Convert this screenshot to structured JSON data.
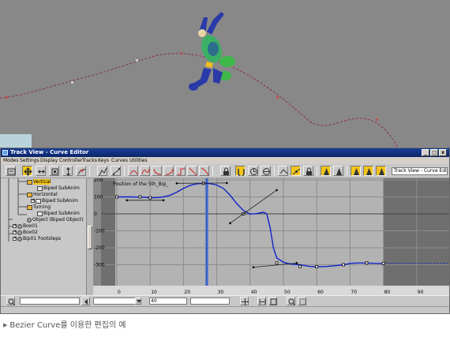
{
  "window": {
    "title": "Track View - Curve Editor",
    "min_label": "_",
    "max_label": "□",
    "close_label": "x"
  },
  "menu": [
    "Modes",
    "Settings",
    "Display",
    "Controller",
    "Tracks",
    "Keys",
    "Curves",
    "Utilities"
  ],
  "toolbar": {
    "name_field": "Track View - Curve Editor"
  },
  "hierarchy": {
    "rows": [
      {
        "label": "Vertical",
        "indent": 33,
        "icon": "orange",
        "selected": true,
        "expander": ""
      },
      {
        "label": "Biped SubAnim",
        "indent": 46,
        "icon": "box",
        "selected": false,
        "expander": ""
      },
      {
        "label": "Horizontal",
        "indent": 33,
        "icon": "orange",
        "selected": false,
        "expander": ""
      },
      {
        "label": "Biped SubAnim",
        "indent": 38,
        "icon": "box",
        "selected": false,
        "expander": "+"
      },
      {
        "label": "Turning",
        "indent": 33,
        "icon": "orange",
        "selected": false,
        "expander": ""
      },
      {
        "label": "Biped SubAnim",
        "indent": 46,
        "icon": "box",
        "selected": false,
        "expander": ""
      },
      {
        "label": "Object (Biped Object)",
        "indent": 33,
        "icon": "sphere",
        "selected": false,
        "expander": ""
      },
      {
        "label": "Box01",
        "indent": 15,
        "icon": "sphere",
        "selected": false,
        "expander": "+"
      },
      {
        "label": "Box02",
        "indent": 15,
        "icon": "sphere",
        "selected": false,
        "expander": "+"
      },
      {
        "label": "Bip01 Footsteps",
        "indent": 15,
        "icon": "sphere",
        "selected": false,
        "expander": "+"
      }
    ]
  },
  "curve_editor": {
    "curve_label": "Position of the 5th_Bip_",
    "y_ticks": [
      "200",
      "100",
      "0",
      "-100",
      "-200",
      "-300"
    ],
    "x_ticks": [
      "0",
      "10",
      "20",
      "30",
      "40",
      "50",
      "60",
      "70",
      "80",
      "90"
    ],
    "current_frame": 27
  },
  "bottombar": {
    "frame_field": "40",
    "value_field": ""
  },
  "caption": {
    "bullet": "▶",
    "text": "Bezier Curve를 이용한 편집의 예"
  },
  "colors": {
    "curve": "#1022c8",
    "motion_path": "#8a2f5a",
    "grid_bg": "#6f6f6f",
    "active_range_bg": "#b3b3b3",
    "time_slider": "#5b7ed6",
    "selected_highlight": "#f2c419"
  }
}
